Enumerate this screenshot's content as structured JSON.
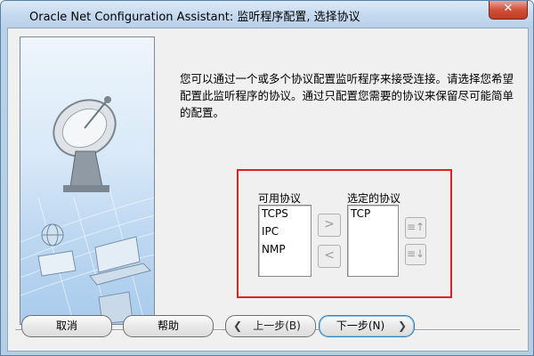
{
  "window": {
    "title": "Oracle Net Configuration Assistant: 监听程序配置, 选择协议",
    "close_label": "✕"
  },
  "description": "您可以通过一个或多个协议配置监听程序来接受连接。请选择您希望配置此监听程序的协议。通过只配置您需要的协议来保留尽可能简单的配置。",
  "protocols": {
    "available_label": "可用协议",
    "selected_label": "选定的协议",
    "available": [
      "TCPS",
      "IPC",
      "NMP"
    ],
    "selected": [
      "TCP"
    ],
    "add_symbol": ">",
    "remove_symbol": "<",
    "move_up_symbol": "≡↑",
    "move_down_symbol": "≡↓"
  },
  "buttons": {
    "cancel": "取消",
    "help": "帮助",
    "back": "上一步(B)",
    "next": "下一步(N)"
  },
  "colors": {
    "highlight_border": "#e02020",
    "titlebar": "#c4d9ef"
  }
}
